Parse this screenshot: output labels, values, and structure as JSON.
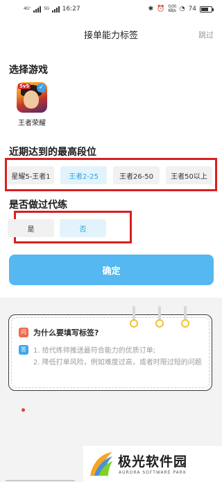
{
  "status_bar": {
    "net_1": "4G⁺",
    "net_2": "5G",
    "time": "16:27",
    "net_speed": "0.00\nKB/s",
    "battery": "74"
  },
  "header": {
    "title": "接单能力标签",
    "skip_label": "跳过"
  },
  "game_section": {
    "title": "选择游戏",
    "game_name": "王者荣耀",
    "icon_tag": "5v5"
  },
  "rank_section": {
    "title": "近期达到的最高段位",
    "options": [
      "星耀5-王者1",
      "王者2-25",
      "王者26-50",
      "王者50以上"
    ],
    "selected_index": 1
  },
  "boost_section": {
    "title": "是否做过代练",
    "options": [
      "是",
      "否"
    ],
    "selected_index": 1
  },
  "confirm_label": "确定",
  "info_card": {
    "question_badge": "问",
    "question": "为什么要填写标签?",
    "answer_badge": "答",
    "answer_line_1": "1. 给代练师推送最符合能力的优质订单;",
    "answer_line_2": "2. 降低打单风险，例如难度过高，或者时限过短的问题"
  },
  "watermark": {
    "name": "极光软件园",
    "sub": "AURORA SOFTWARE PARK"
  },
  "colors": {
    "accent": "#55b8f0",
    "selected_text": "#2aa3e0",
    "annotation_red": "#d81f1f"
  }
}
